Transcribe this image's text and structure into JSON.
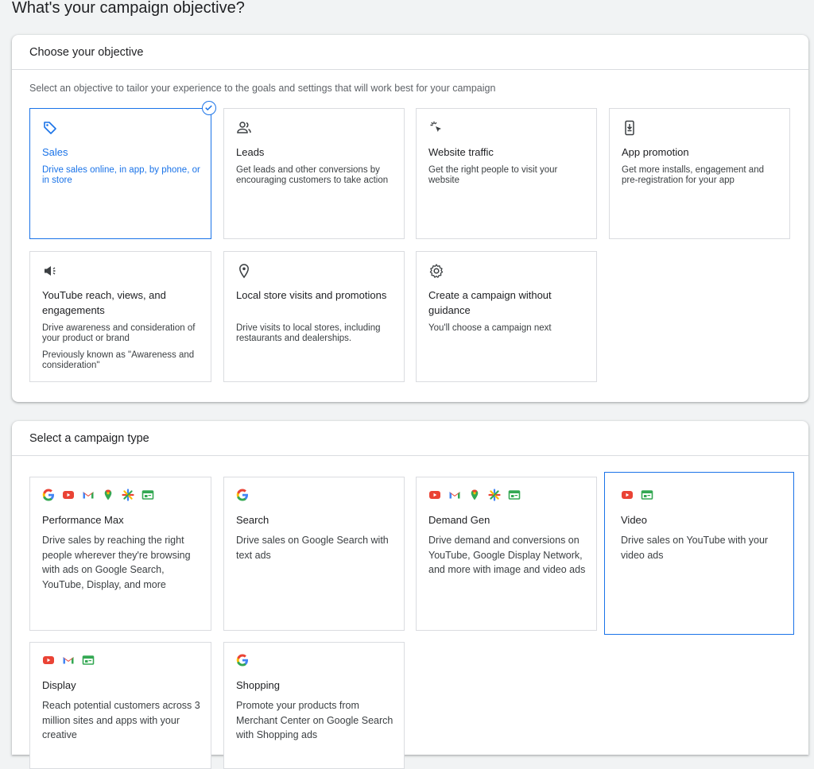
{
  "page": {
    "title": "What's your campaign objective?"
  },
  "objective_panel": {
    "header": "Choose your objective",
    "description": "Select an objective to tailor your experience to the goals and settings that will work best for your campaign",
    "cards": [
      {
        "title": "Sales",
        "desc": "Drive sales online, in app, by phone, or in store",
        "icon": "tag-icon",
        "selected": true
      },
      {
        "title": "Leads",
        "desc": "Get leads and other conversions by encouraging customers to take action",
        "icon": "people-icon"
      },
      {
        "title": "Website traffic",
        "desc": "Get the right people to visit your website",
        "icon": "cursor-click-icon"
      },
      {
        "title": "App promotion",
        "desc": "Get more installs, engagement and pre-registration for your app",
        "icon": "phone-download-icon"
      },
      {
        "title": "YouTube reach, views, and engagements",
        "desc": "Drive awareness and consideration of your product or brand",
        "note": "Previously known as \"Awareness and consideration\"",
        "icon": "megaphone-icon"
      },
      {
        "title": "Local store visits and promotions",
        "desc": "Drive visits to local stores, including restaurants and dealerships.",
        "icon": "location-pin-icon"
      },
      {
        "title": "Create a campaign without guidance",
        "desc": "You'll choose a campaign next",
        "icon": "gear-icon"
      }
    ]
  },
  "type_panel": {
    "header": "Select a campaign type",
    "cards": [
      {
        "title": "Performance Max",
        "desc": "Drive sales by reaching the right people wherever they're browsing with ads on Google Search, YouTube, Display, and more"
      },
      {
        "title": "Search",
        "desc": "Drive sales on Google Search with text ads"
      },
      {
        "title": "Demand Gen",
        "desc": "Drive demand and conversions on YouTube, Google Display Network, and more with image and video ads"
      },
      {
        "title": "Video",
        "desc": "Drive sales on YouTube with your video ads",
        "selected": true
      },
      {
        "title": "Display",
        "desc": "Reach potential customers across 3 million sites and apps with your creative"
      },
      {
        "title": "Shopping",
        "desc": "Promote your products from Merchant Center on Google Search with Shopping ads"
      }
    ]
  },
  "colors": {
    "accent": "#1a73e8",
    "youtube": "#ea4335",
    "gmail_red": "#ea4335",
    "green": "#34a853",
    "yellow": "#fbbc04"
  }
}
